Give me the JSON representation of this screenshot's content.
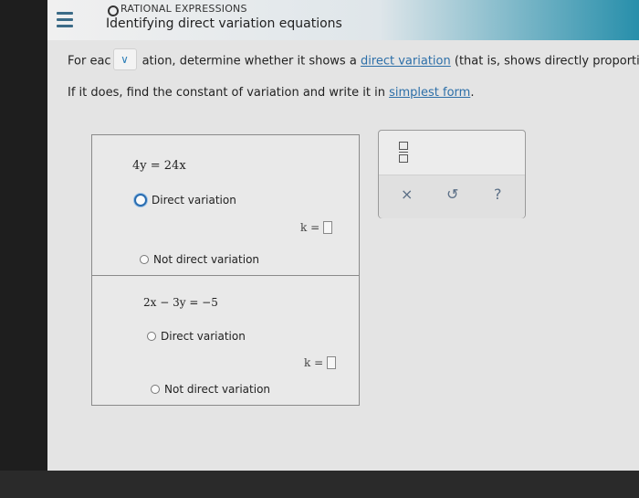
{
  "header": {
    "topic": "RATIONAL EXPRESSIONS",
    "title": "Identifying direct variation equations"
  },
  "instructions": {
    "line1_before": "For eac",
    "dropdown_icon": "chevron-down-icon",
    "line1_after": "ation, determine whether it shows a",
    "line1_link": "direct variation",
    "line1_tail": "(that is, shows directly proportio",
    "line2_before": "If it does, find the constant of variation and write it in",
    "line2_link": "simplest form",
    "line2_after": "."
  },
  "problems": [
    {
      "equation": "4y = 24x",
      "option_direct": "Direct variation",
      "k_label": "k =",
      "option_not": "Not direct variation"
    },
    {
      "equation": "2x − 3y = −5",
      "option_direct": "Direct variation",
      "k_label": "k =",
      "option_not": "Not direct variation"
    }
  ],
  "toolbar": {
    "fraction_icon": "fraction-icon",
    "clear": "×",
    "undo": "↺",
    "help": "?"
  },
  "colors": {
    "header_accent": "#1f8ba8",
    "link": "#2d6fa8",
    "focus": "#2a6db0"
  }
}
